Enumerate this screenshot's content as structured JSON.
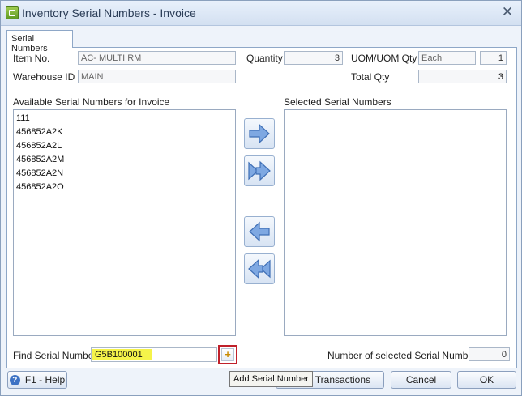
{
  "window": {
    "title": "Inventory Serial Numbers - Invoice",
    "close_glyph": "✕"
  },
  "tabs": [
    {
      "label": "Serial Numbers"
    }
  ],
  "header": {
    "item_no_label": "Item No.",
    "item_no_value": "AC- MULTI RM",
    "warehouse_label": "Warehouse ID",
    "warehouse_value": "MAIN",
    "quantity_label": "Quantity",
    "quantity_value": "3",
    "uom_label": "UOM/UOM Qty",
    "uom_value": "Each",
    "uom_qty_value": "1",
    "total_qty_label": "Total Qty",
    "total_qty_value": "3"
  },
  "available": {
    "label": "Available Serial Numbers for Invoice",
    "items": [
      "111",
      "456852A2K",
      "456852A2L",
      "456852A2M",
      "456852A2N",
      "456852A2O"
    ]
  },
  "selected": {
    "label": "Selected Serial Numbers",
    "items": []
  },
  "transfer_buttons": {
    "add_one_icon": "arrow-right-icon",
    "add_all_icon": "double-arrow-right-icon",
    "remove_one_icon": "arrow-left-icon",
    "remove_all_icon": "double-arrow-left-icon"
  },
  "find": {
    "label": "Find Serial Number",
    "value": "G5B100001",
    "highlight_color": "#f5f34a",
    "add_glyph": "+",
    "add_tooltip": "Add Serial Number",
    "frame_color": "#c0202a"
  },
  "count": {
    "label": "Number of selected Serial Numbers",
    "value": "0"
  },
  "footer": {
    "help_label": "F1 - Help",
    "help_glyph": "?",
    "view_transactions_visible_text": "w Transactions",
    "cancel_label": "Cancel",
    "ok_label": "OK"
  }
}
